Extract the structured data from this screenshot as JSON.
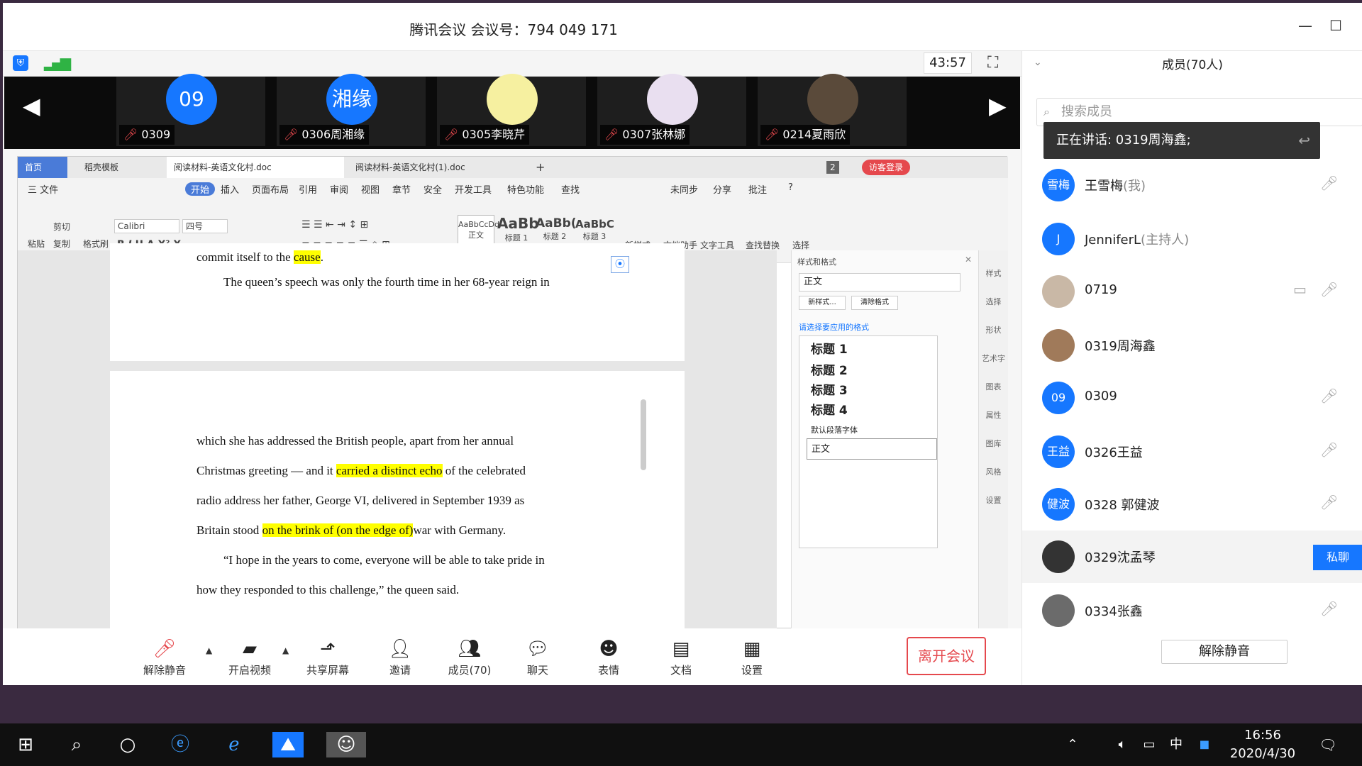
{
  "window": {
    "title": "腾讯会议 会议号：794 049 171",
    "minimize": "—",
    "maximize": "☐"
  },
  "toolbar": {
    "timer": "43:57",
    "expand": "⛶",
    "shield": "⛨",
    "signal": "▮"
  },
  "video_tiles": [
    {
      "avatar": "09",
      "name": "0309"
    },
    {
      "avatar": "湘缘",
      "name": "0306周湘缘"
    },
    {
      "avatar": "",
      "name": "0305李晓芹"
    },
    {
      "avatar": "",
      "name": "0307张林娜"
    },
    {
      "avatar": "",
      "name": "0214夏雨欣"
    }
  ],
  "wps": {
    "tabs": [
      "首页",
      "稻壳模板",
      "阅读材料-英语文化村.doc",
      "阅读材料-英语文化村(1).doc",
      "+"
    ],
    "badge_count": "2",
    "login": "访客登录",
    "menus": [
      "三 文件",
      "开始",
      "插入",
      "页面布局",
      "引用",
      "审阅",
      "视图",
      "章节",
      "安全",
      "开发工具",
      "特色功能",
      "查找"
    ],
    "menu_right": [
      "未同步",
      "分享",
      "批注",
      "?"
    ],
    "font_name": "Calibri",
    "font_size": "四号",
    "clipboard": [
      "粘贴",
      "剪切",
      "复制",
      "格式刷"
    ],
    "styles": [
      {
        "preview": "AaBbCcDd",
        "label": "正文"
      },
      {
        "preview": "AaBb",
        "label": "标题 1"
      },
      {
        "preview": "AaBb(",
        "label": "标题 2"
      },
      {
        "preview": "AaBbC",
        "label": "标题 3"
      }
    ],
    "tools": [
      "新样式",
      "文档助手",
      "文字工具",
      "查找替换",
      "选择"
    ]
  },
  "document": {
    "p1_tail": "commit itself to the ",
    "p1_hl": "cause",
    "p1_end": ".",
    "p2": "The queen’s speech was only the fourth time in her 68-year reign in",
    "line1": "which she has addressed the British people, apart from her annual",
    "line2_a": "Christmas greeting — and it ",
    "line2_hl": "carried a distinct echo",
    "line2_b": " of the celebrated",
    "line3": "radio address her father, George VI, delivered in September 1939 as",
    "line4_a": "Britain stood ",
    "line4_hl": "on the brink of (on the edge of)",
    "line4_b": "war with Germany.",
    "line5": "“I hope in the years to come, everyone will be able to take pride in",
    "line6": "how they responded to this challenge,” the queen said."
  },
  "style_pane": {
    "title": "样式和格式",
    "current": "正文",
    "new_style": "新样式...",
    "clear": "清除格式",
    "prompt": "请选择要应用的格式",
    "items": [
      "标题 1",
      "标题 2",
      "标题 3",
      "标题 4",
      "默认段落字体",
      "正文"
    ]
  },
  "side_tools": [
    "样式",
    "选择",
    "形状",
    "艺术字",
    "图表",
    "属性",
    "图库",
    "风格",
    "设置"
  ],
  "bottom": {
    "buttons": [
      "解除静音",
      "开启视频",
      "共享屏幕",
      "邀请",
      "成员(70)",
      "聊天",
      "表情",
      "文档",
      "设置"
    ],
    "leave": "离开会议"
  },
  "members_panel": {
    "title": "成员(70人)",
    "search_placeholder": "搜索成员",
    "toast": "正在讲话: 0319周海鑫;",
    "members": [
      {
        "avatar": "雪梅",
        "name": "王雪梅",
        "role": "(我)"
      },
      {
        "avatar": "J",
        "name": "JenniferL",
        "role": "(主持人)"
      },
      {
        "avatar": "",
        "name": "0719",
        "role": ""
      },
      {
        "avatar": "",
        "name": "0319周海鑫",
        "role": ""
      },
      {
        "avatar": "09",
        "name": "0309",
        "role": ""
      },
      {
        "avatar": "王益",
        "name": "0326王益",
        "role": ""
      },
      {
        "avatar": "健波",
        "name": "0328 郭健波",
        "role": ""
      },
      {
        "avatar": "",
        "name": "0329沈孟琴",
        "role": ""
      },
      {
        "avatar": "",
        "name": "0334张鑫",
        "role": ""
      }
    ],
    "private_chat": "私聊",
    "unmute_all": "解除静音"
  },
  "taskbar": {
    "time": "16:56",
    "date": "2020/4/30",
    "ime": "中"
  },
  "colors": {
    "accent": "#1677ff",
    "leave": "#e5484d",
    "highlight": "#ffff00"
  }
}
